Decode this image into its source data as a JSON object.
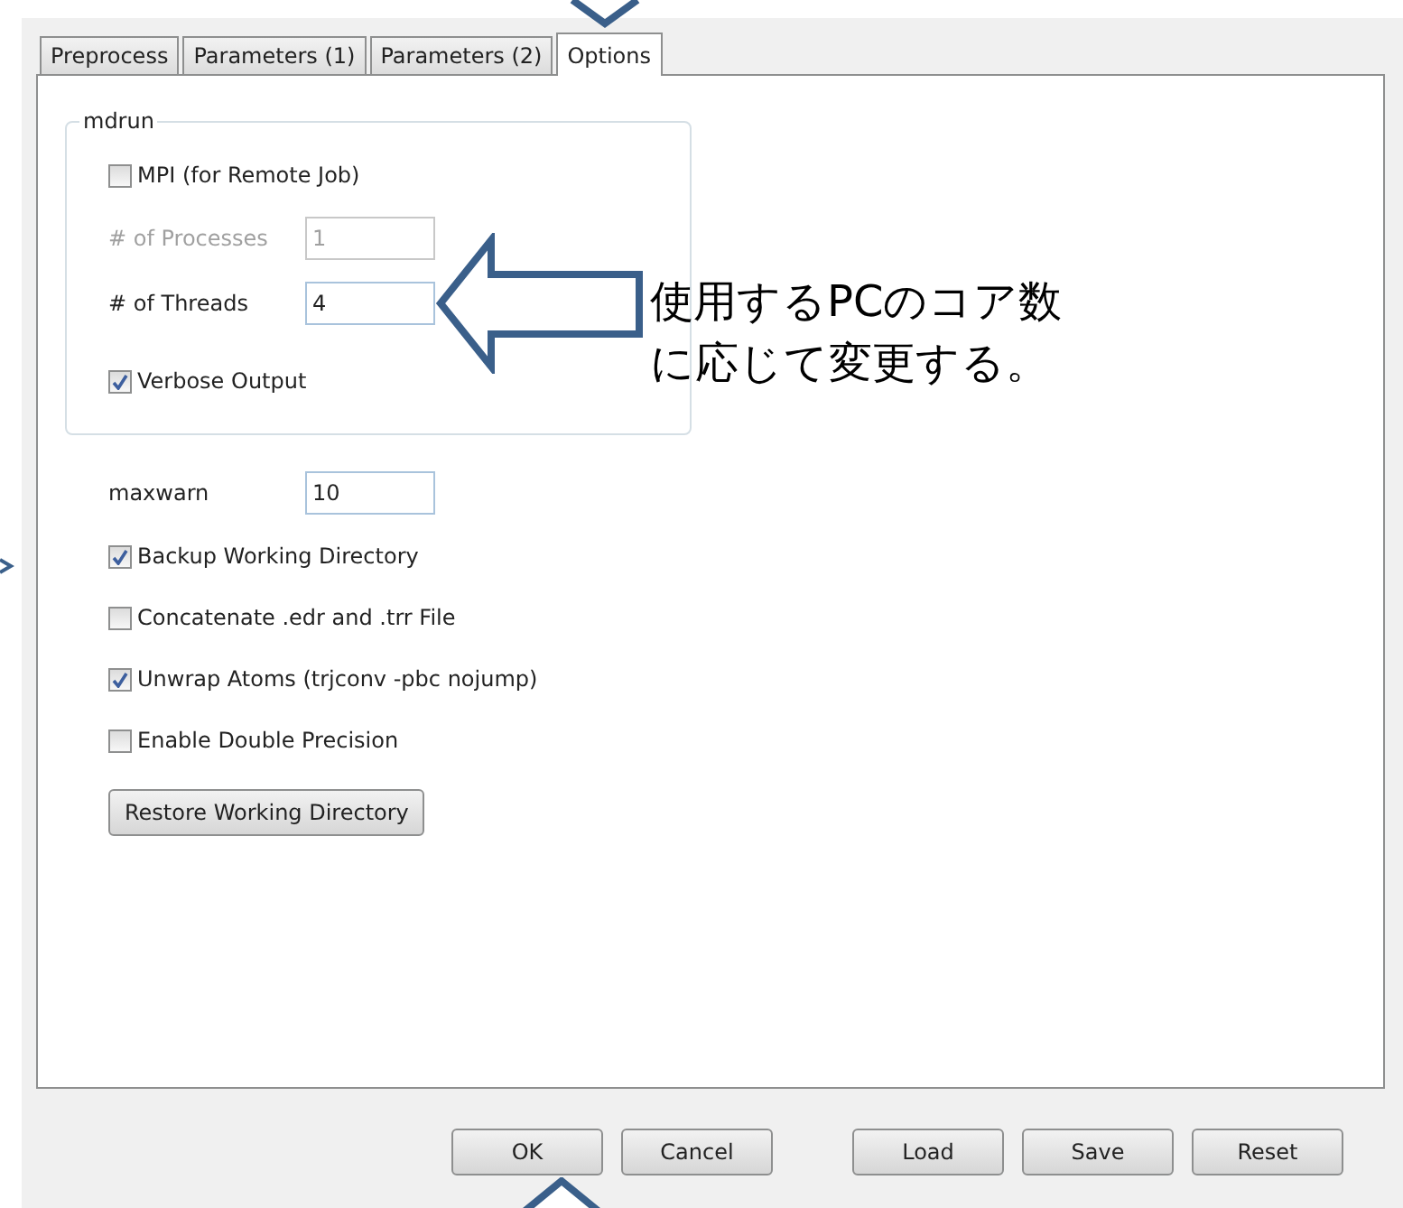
{
  "tabs": [
    {
      "label": "Preprocess",
      "selected": false
    },
    {
      "label": "Parameters (1)",
      "selected": false
    },
    {
      "label": "Parameters (2)",
      "selected": false
    },
    {
      "label": "Options",
      "selected": true
    }
  ],
  "mdrun": {
    "title": "mdrun",
    "items": [
      {
        "kind": "checkbox",
        "label": "MPI (for Remote Job)",
        "checked": false
      },
      {
        "kind": "field",
        "label": "# of Processes",
        "value": "1",
        "disabled": true
      },
      {
        "kind": "field",
        "label": "# of Threads",
        "value": "4",
        "disabled": false
      },
      {
        "kind": "checkbox",
        "label": "Verbose Output",
        "checked": true
      }
    ]
  },
  "options": [
    {
      "kind": "field",
      "label": "maxwarn",
      "value": "10",
      "disabled": false
    },
    {
      "kind": "checkbox",
      "label": "Backup Working Directory",
      "checked": true
    },
    {
      "kind": "checkbox",
      "label": "Concatenate .edr and .trr File",
      "checked": false
    },
    {
      "kind": "checkbox",
      "label": "Unwrap Atoms (trjconv -pbc nojump)",
      "checked": true
    },
    {
      "kind": "checkbox",
      "label": "Enable Double Precision",
      "checked": false
    },
    {
      "kind": "button",
      "label": "Restore Working Directory"
    }
  ],
  "dialog_buttons": [
    {
      "label": "OK"
    },
    {
      "label": "Cancel"
    }
  ],
  "file_buttons": [
    {
      "label": "Load"
    },
    {
      "label": "Save"
    },
    {
      "label": "Reset"
    }
  ],
  "annotation": {
    "lines": [
      "使用するPCのコア数",
      "に応じて変更する。"
    ]
  }
}
